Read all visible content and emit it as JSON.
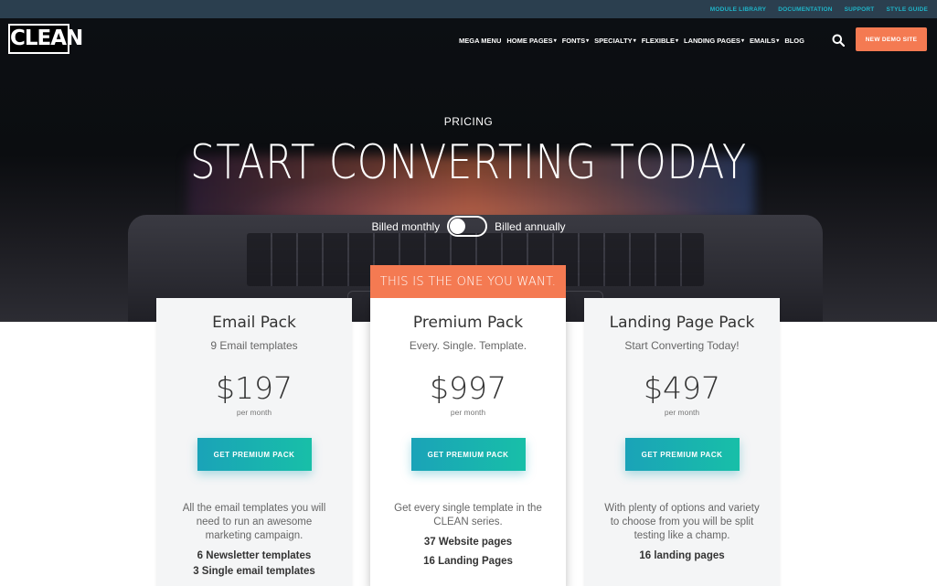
{
  "topbar": {
    "links": [
      "MODULE LIBRARY",
      "DOCUMENTATION",
      "SUPPORT",
      "STYLE GUIDE"
    ]
  },
  "header": {
    "logo": "CLEAN",
    "nav": [
      {
        "label": "MEGA MENU",
        "dropdown": false
      },
      {
        "label": "HOME PAGES",
        "dropdown": true
      },
      {
        "label": "FONTS",
        "dropdown": true
      },
      {
        "label": "SPECIALTY",
        "dropdown": true
      },
      {
        "label": "FLEXIBLE",
        "dropdown": true
      },
      {
        "label": "LANDING PAGES",
        "dropdown": true
      },
      {
        "label": "EMAILS",
        "dropdown": true
      },
      {
        "label": "BLOG",
        "dropdown": false
      }
    ],
    "demo_button": "NEW DEMO SITE"
  },
  "hero": {
    "eyebrow": "PRICING",
    "title": "START CONVERTING TODAY",
    "billed_monthly": "Billed monthly",
    "billed_annually": "Billed annually",
    "toggle_state": "monthly"
  },
  "featured_banner": "THIS IS THE ONE YOU WANT.",
  "plans": [
    {
      "name": "Email Pack",
      "subtitle": "9 Email templates",
      "price": "$197",
      "period": "per month",
      "cta": "GET PREMIUM PACK",
      "description": "All the email templates you will need to run an awesome marketing campaign.",
      "features": [
        "6 Newsletter templates",
        "3 Single email templates"
      ]
    },
    {
      "name": "Premium Pack",
      "subtitle": "Every. Single. Template.",
      "price": "$997",
      "period": "per month",
      "cta": "GET PREMIUM PACK",
      "description": "Get every single template in the CLEAN series.",
      "features": [
        "37 Website pages",
        "16 Landing Pages"
      ]
    },
    {
      "name": "Landing Page Pack",
      "subtitle": "Start Converting Today!",
      "price": "$497",
      "period": "per month",
      "cta": "GET PREMIUM PACK",
      "description": "With plenty of options and variety to choose from you will be split testing like a champ.",
      "features": [
        "16 landing pages"
      ]
    }
  ],
  "colors": {
    "accent": "#f47a52",
    "cta_start": "#1aa3b8",
    "cta_end": "#18bfa8",
    "topbar_bg": "#2b3f4f",
    "topbar_link": "#1fb4c8"
  }
}
